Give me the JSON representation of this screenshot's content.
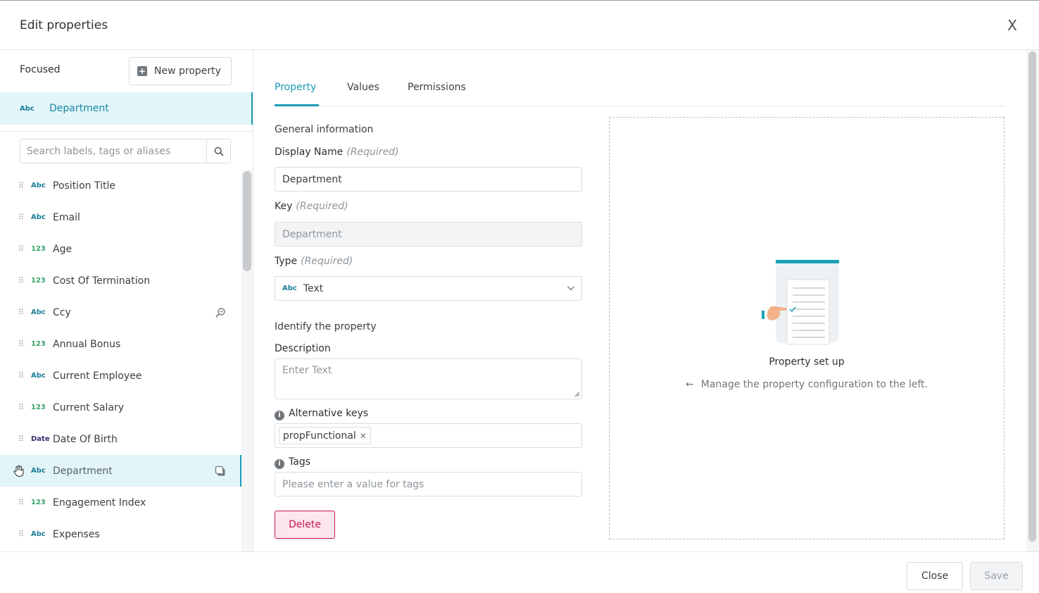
{
  "header": {
    "title": "Edit properties",
    "close_glyph": "X"
  },
  "left": {
    "focused_label": "Focused",
    "new_property_label": "New property",
    "focused_item": {
      "tag": "Abc",
      "name": "Department"
    },
    "search_placeholder": "Search labels, tags or aliases",
    "items": [
      {
        "tag": "Abc",
        "type": "text",
        "name": "Position Title"
      },
      {
        "tag": "Abc",
        "type": "text",
        "name": "Email"
      },
      {
        "tag": "123",
        "type": "number",
        "name": "Age"
      },
      {
        "tag": "123",
        "type": "number",
        "name": "Cost Of Termination"
      },
      {
        "tag": "Abc",
        "type": "text",
        "name": "Ccy",
        "icon": "search-zoom-icon"
      },
      {
        "tag": "123",
        "type": "number",
        "name": "Annual Bonus"
      },
      {
        "tag": "Abc",
        "type": "text",
        "name": "Current Employee"
      },
      {
        "tag": "123",
        "type": "number",
        "name": "Current Salary"
      },
      {
        "tag": "Date",
        "type": "date",
        "name": "Date Of Birth"
      },
      {
        "tag": "Abc",
        "type": "text",
        "name": "Department",
        "hovered": true,
        "icon": "add-copy-icon"
      },
      {
        "tag": "123",
        "type": "number",
        "name": "Engagement Index"
      },
      {
        "tag": "Abc",
        "type": "text",
        "name": "Expenses"
      }
    ]
  },
  "tabs": [
    {
      "label": "Property",
      "active": true
    },
    {
      "label": "Values",
      "active": false
    },
    {
      "label": "Permissions",
      "active": false
    }
  ],
  "form": {
    "general_title": "General information",
    "display_name_label": "Display Name",
    "required_text": "(Required)",
    "display_name_value": "Department",
    "key_label": "Key",
    "key_value": "Department",
    "type_label": "Type",
    "type_tag": "Abc",
    "type_value": "Text",
    "identify_title": "Identify the property",
    "description_label": "Description",
    "description_placeholder": "Enter Text",
    "alt_keys_label": "Alternative keys",
    "alt_keys_chip": "propFunctional",
    "tags_label": "Tags",
    "tags_placeholder": "Please enter a value for tags",
    "delete_label": "Delete"
  },
  "placeholder": {
    "title": "Property set up",
    "subtitle": "Manage the property configuration to the left."
  },
  "footer": {
    "close_label": "Close",
    "save_label": "Save"
  },
  "colors": {
    "accent": "#1a9bb5",
    "danger": "#c4174f",
    "number_tag": "#3aa36b",
    "date_tag": "#3d2f6e"
  }
}
